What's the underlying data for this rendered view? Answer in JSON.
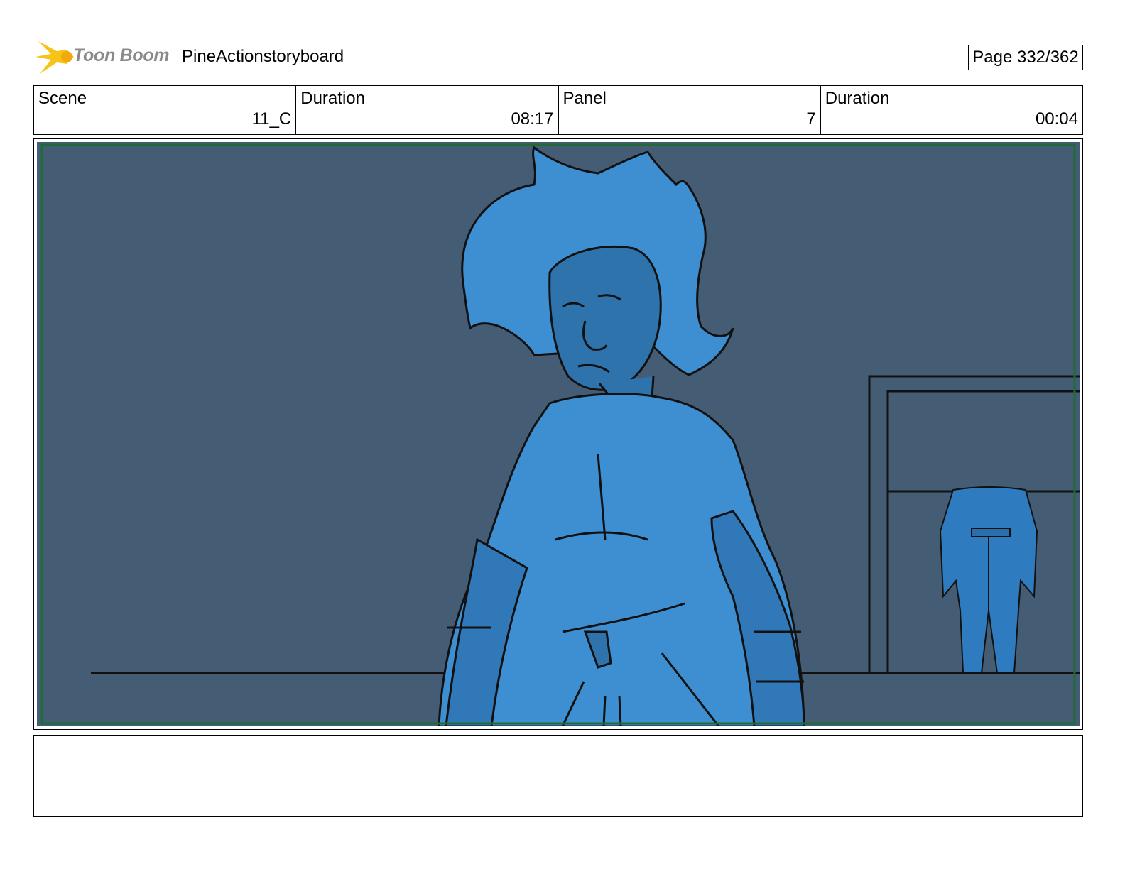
{
  "header": {
    "logo": {
      "brand_text": "Toon Boom",
      "icon": "starburst-logo-icon"
    },
    "project_title": "PineActionstoryboard",
    "page_indicator": "Page 332/362"
  },
  "info_table": {
    "cells": [
      {
        "label": "Scene",
        "value": "11_C"
      },
      {
        "label": "Duration",
        "value": "08:17"
      },
      {
        "label": "Panel",
        "value": "7"
      },
      {
        "label": "Duration",
        "value": "00:04"
      }
    ]
  },
  "panel": {
    "image": "storyboard-sketch"
  },
  "notes": {
    "text": ""
  },
  "colors": {
    "panel_background": "#455d74",
    "character_fill": "#3d8fd1",
    "line_art": "#111111",
    "safe_area_border": "#1e6b38",
    "logo_accent": "#f6c417",
    "logo_text": "#8a8a8a"
  }
}
